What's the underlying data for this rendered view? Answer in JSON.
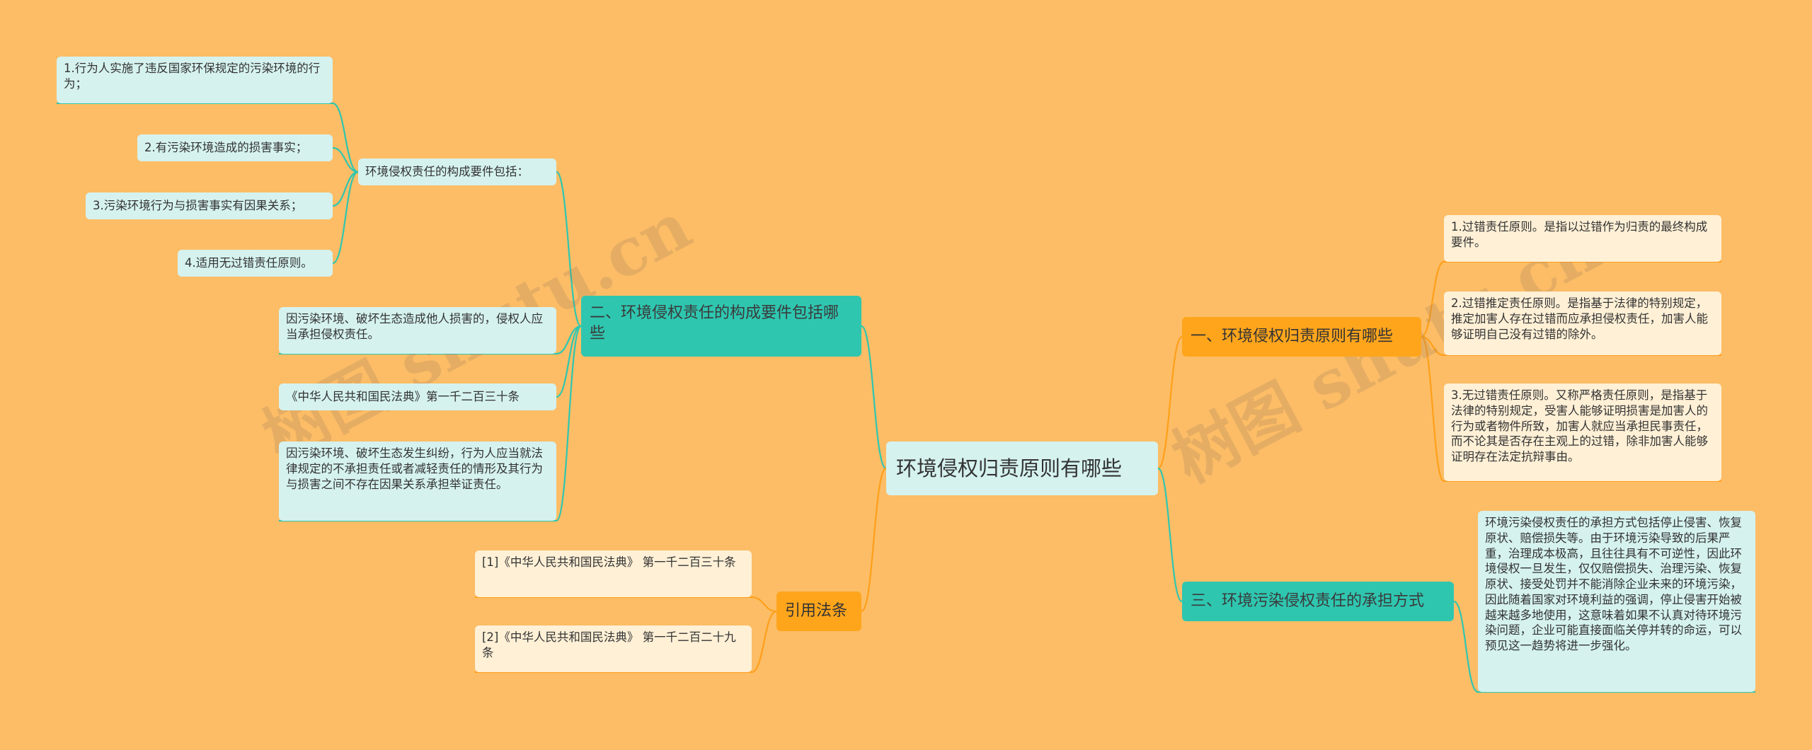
{
  "root": {
    "label": "环境侵权归责原则有哪些"
  },
  "left": {
    "branch_elements": {
      "label": "二、环境侵权责任的构成要件包括哪些",
      "sub": {
        "label": "环境侵权责任的构成要件包括：",
        "items": [
          "1.行为人实施了违反国家环保规定的污染环境的行为；",
          "2.有污染环境造成的损害事实；",
          "3.污染环境行为与损害事实有因果关系；",
          "4.适用无过错责任原则。"
        ]
      },
      "notes": [
        "因污染环境、破坏生态造成他人损害的，侵权人应当承担侵权责任。",
        "《中华人民共和国民法典》第一千二百三十条",
        "因污染环境、破坏生态发生纠纷，行为人应当就法律规定的不承担责任或者减轻责任的情形及其行为与损害之间不存在因果关系承担举证责任。"
      ]
    },
    "branch_citations": {
      "label": "引用法条",
      "items": [
        "[1]《中华人民共和国民法典》 第一千二百三十条",
        "[2]《中华人民共和国民法典》 第一千二百二十九条"
      ]
    }
  },
  "right": {
    "branch_principles": {
      "label": "一、环境侵权归责原则有哪些",
      "items": [
        "1.过错责任原则。是指以过错作为归责的最终构成要件。",
        "2.过错推定责任原则。是指基于法律的特别规定，推定加害人存在过错而应承担侵权责任，加害人能够证明自己没有过错的除外。",
        "3.无过错责任原则。又称严格责任原则，是指基于法律的特别规定，受害人能够证明损害是加害人的行为或者物件所致，加害人就应当承担民事责任，而不论其是否存在主观上的过错，除非加害人能够证明存在法定抗辩事由。"
      ]
    },
    "branch_liability": {
      "label": "三、环境污染侵权责任的承担方式",
      "items": [
        "环境污染侵权责任的承担方式包括停止侵害、恢复原状、赔偿损失等。由于环境污染导致的后果严重，治理成本极高，且往往具有不可逆性，因此环境侵权一旦发生，仅仅赔偿损失、治理污染、恢复原状、接受处罚并不能消除企业未来的环境污染，因此随着国家对环境利益的强调，停止侵害开始被越来越多地使用，这意味着如果不认真对待环境污染问题，企业可能直接面临关停并转的命运，可以预见这一趋势将进一步强化。"
      ]
    }
  },
  "watermarks": [
    "树图 shutu.cn",
    "树图 shutu.cn"
  ],
  "colors": {
    "background": "#fcbd66",
    "teal_branch": "#2fc6b0",
    "orange_branch": "#ffa51c",
    "cyan_leaf": "#d5f2ef",
    "cream_leaf": "#fff0d6",
    "teal_line": "#2fc6b0",
    "orange_line": "#ff9f1a"
  }
}
